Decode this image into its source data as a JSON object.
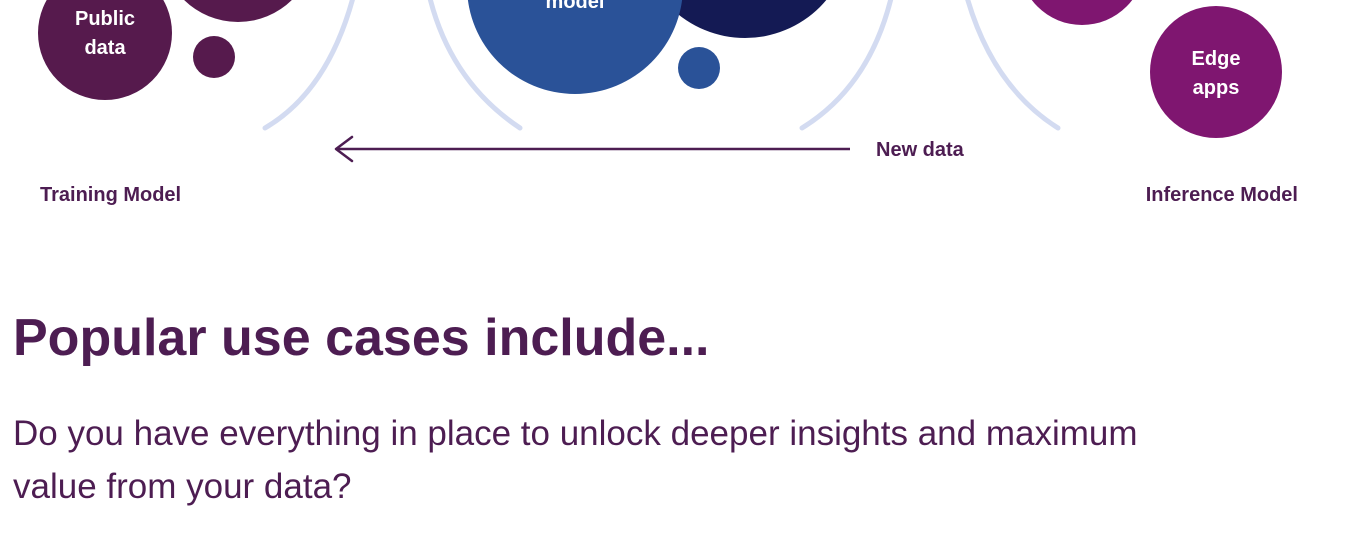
{
  "diagram": {
    "bubbles": {
      "public_data": [
        "Public",
        "data"
      ],
      "model": "model",
      "edge_apps": [
        "Edge",
        "apps"
      ]
    },
    "arrow_label": "New data",
    "training_label": "Training Model",
    "inference_label": "Inference Model",
    "colors": {
      "plum_dark": "#561a4d",
      "purple": "#7f1670",
      "blue": "#2a5298",
      "navy": "#141a54",
      "arc": "#d3dbf1",
      "text": "#4d1d52"
    }
  },
  "section": {
    "heading": "Popular use cases include...",
    "body": "Do you have everything in place to unlock deeper insights and maximum value from your data?"
  }
}
